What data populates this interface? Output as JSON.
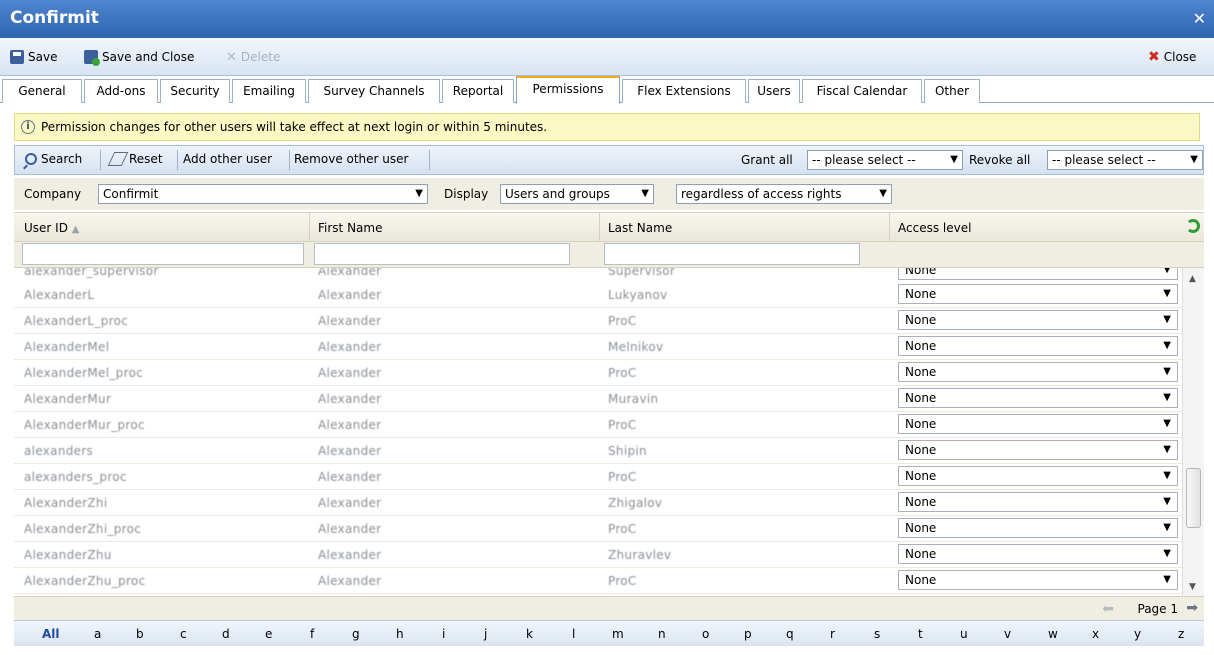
{
  "window": {
    "title": "Confirmit"
  },
  "toolbar": {
    "save": "Save",
    "save_close": "Save and Close",
    "delete": "Delete",
    "close": "Close"
  },
  "tabs": [
    "General",
    "Add-ons",
    "Security",
    "Emailing",
    "Survey Channels",
    "Reportal",
    "Permissions",
    "Flex Extensions",
    "Users",
    "Fiscal Calendar",
    "Other"
  ],
  "notice": "Permission changes for other users will take effect at next login or within 5 minutes.",
  "actions": {
    "search": "Search",
    "reset": "Reset",
    "add_user": "Add other user",
    "remove_user": "Remove other user",
    "grant_all": "Grant all",
    "grant_select": "-- please select --",
    "revoke_all": "Revoke all",
    "revoke_select": "-- please select --"
  },
  "filters": {
    "company_label": "Company",
    "company_value": "Confirmit",
    "display_label": "Display",
    "display_value": "Users and groups",
    "rights_value": "regardless of access rights"
  },
  "columns": {
    "user_id": "User ID",
    "first_name": "First Name",
    "last_name": "Last Name",
    "access_level": "Access level"
  },
  "rows": [
    {
      "user": "alexander_supervisor",
      "first": "Alexander",
      "last": "Supervisor",
      "access": "None"
    },
    {
      "user": "AlexanderL",
      "first": "Alexander",
      "last": "Lukyanov",
      "access": "None"
    },
    {
      "user": "AlexanderL_proc",
      "first": "Alexander",
      "last": "ProC",
      "access": "None"
    },
    {
      "user": "AlexanderMel",
      "first": "Alexander",
      "last": "Melnikov",
      "access": "None"
    },
    {
      "user": "AlexanderMel_proc",
      "first": "Alexander",
      "last": "ProC",
      "access": "None"
    },
    {
      "user": "AlexanderMur",
      "first": "Alexander",
      "last": "Muravin",
      "access": "None"
    },
    {
      "user": "AlexanderMur_proc",
      "first": "Alexander",
      "last": "ProC",
      "access": "None"
    },
    {
      "user": "alexanders",
      "first": "Alexander",
      "last": "Shipin",
      "access": "None"
    },
    {
      "user": "alexanders_proc",
      "first": "Alexander",
      "last": "ProC",
      "access": "None"
    },
    {
      "user": "AlexanderZhi",
      "first": "Alexander",
      "last": "Zhigalov",
      "access": "None"
    },
    {
      "user": "AlexanderZhi_proc",
      "first": "Alexander",
      "last": "ProC",
      "access": "None"
    },
    {
      "user": "AlexanderZhu",
      "first": "Alexander",
      "last": "Zhuravlev",
      "access": "None"
    },
    {
      "user": "AlexanderZhu_proc",
      "first": "Alexander",
      "last": "ProC",
      "access": "None"
    }
  ],
  "pager": {
    "page": "Page 1"
  },
  "alphabet": [
    "All",
    "a",
    "b",
    "c",
    "d",
    "e",
    "f",
    "g",
    "h",
    "i",
    "j",
    "k",
    "l",
    "m",
    "n",
    "o",
    "p",
    "q",
    "r",
    "s",
    "t",
    "u",
    "v",
    "w",
    "x",
    "y",
    "z"
  ]
}
